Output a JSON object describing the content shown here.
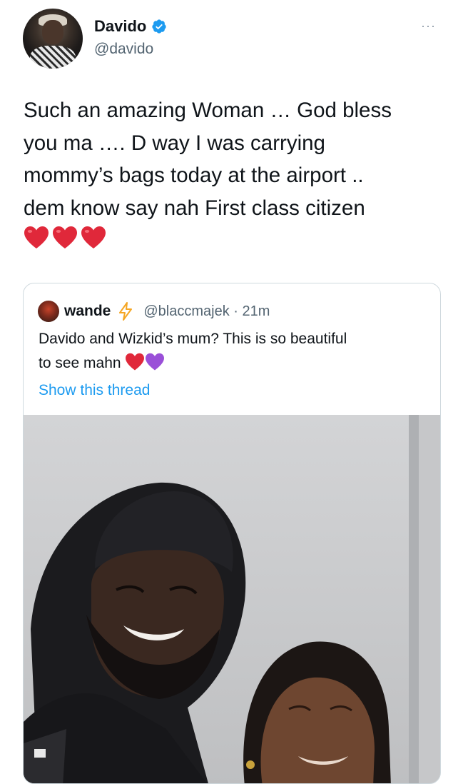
{
  "tweet": {
    "author_name": "Davido",
    "author_handle": "@davido",
    "more_label": "···",
    "text": "Such an amazing Woman … God bless\nyou ma …. D way I was carrying\nmommy’s bags today at the airport ..\ndem know say nah First class citizen",
    "hearts": [
      "red-heart",
      "red-heart",
      "red-heart"
    ]
  },
  "quote": {
    "author_name": "wande",
    "author_handle": "@blaccmajek · 21m",
    "text_line1": "Davido and Wizkid’s mum? This is so beautiful",
    "text_line2": "to see mahn",
    "emoji": [
      "red-heart",
      "purple-heart"
    ],
    "show_thread_label": "Show this thread"
  },
  "colors": {
    "verified": "#1d9bf0",
    "link": "#1d9bf0",
    "secondary_text": "#536471",
    "red_heart": "#e0283a",
    "purple_heart": "#9a4fd8",
    "bolt": "#f5a623"
  }
}
